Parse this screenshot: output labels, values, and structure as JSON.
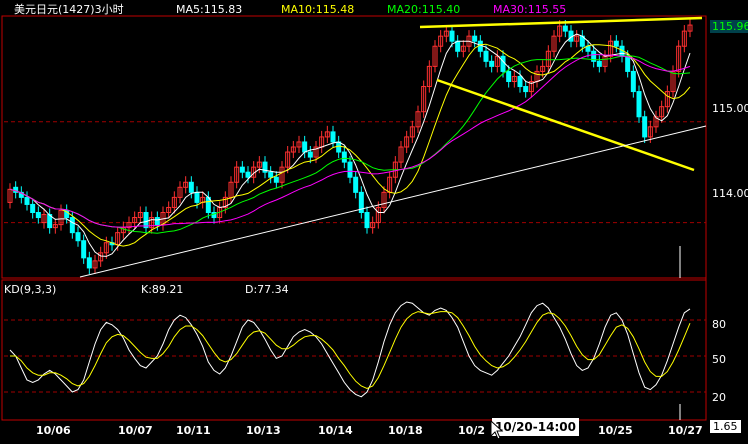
{
  "colors": {
    "ma5": "#ffffff",
    "ma10": "#ffff00",
    "ma20": "#00ff00",
    "ma30": "#ff00ff",
    "k": "#ffffff",
    "d": "#ffff00",
    "up": "#ff3030",
    "down": "#00ffff",
    "trend_yellow": "#ffff00",
    "trend_white": "#ffffff",
    "grid": "#a00000"
  },
  "header": {
    "symbol": "美元日元(1427)3小时",
    "ma5": "MA5:115.83",
    "ma10": "MA10:115.48",
    "ma20": "MA20:115.40",
    "ma30": "MA30:115.55"
  },
  "kd_header": {
    "title": "KD(9,3,3)",
    "k": "K:89.21",
    "d": "D:77.34"
  },
  "price_badge": "115.96",
  "kd_badge": "1.65",
  "cursor_label": "10/20-14:00",
  "x_axis": [
    "10/06",
    "10/07",
    "10/11",
    "10/13",
    "10/14",
    "10/18",
    "10/2",
    "10/25",
    "10/27"
  ],
  "price_ticks": [
    "115.00",
    "114.00"
  ],
  "kd_ticks": [
    "80",
    "50",
    "20"
  ],
  "chart_data": [
    {
      "type": "candlestick",
      "title": "美元日元(1427)3小时",
      "series": [
        {
          "name": "MA5",
          "value": 115.83
        },
        {
          "name": "MA10",
          "value": 115.48
        },
        {
          "name": "MA20",
          "value": 115.4
        },
        {
          "name": "MA30",
          "value": 115.55
        }
      ],
      "y_ticks": [
        115.0,
        114.0
      ],
      "last_price": 115.96,
      "x_categories": [
        "10/06",
        "10/07",
        "10/11",
        "10/13",
        "10/14",
        "10/18",
        "10/2",
        "10/25",
        "10/27"
      ],
      "close": [
        114.33,
        114.3,
        114.25,
        114.18,
        114.1,
        114.05,
        114.08,
        113.95,
        113.98,
        114.12,
        114.05,
        113.9,
        113.82,
        113.65,
        113.55,
        113.62,
        113.7,
        113.8,
        113.78,
        113.9,
        113.95,
        114.0,
        114.05,
        114.1,
        113.95,
        114.05,
        113.98,
        114.1,
        114.15,
        114.25,
        114.35,
        114.4,
        114.3,
        114.2,
        114.25,
        114.1,
        114.05,
        114.15,
        114.25,
        114.4,
        114.55,
        114.5,
        114.45,
        114.55,
        114.6,
        114.5,
        114.45,
        114.4,
        114.55,
        114.7,
        114.75,
        114.8,
        114.7,
        114.65,
        114.75,
        114.85,
        114.9,
        114.8,
        114.7,
        114.6,
        114.45,
        114.3,
        114.1,
        113.95,
        114.0,
        114.15,
        114.3,
        114.45,
        114.6,
        114.75,
        114.85,
        114.95,
        115.1,
        115.35,
        115.55,
        115.75,
        115.85,
        115.9,
        115.8,
        115.7,
        115.75,
        115.85,
        115.8,
        115.7,
        115.6,
        115.55,
        115.65,
        115.5,
        115.4,
        115.45,
        115.35,
        115.3,
        115.4,
        115.5,
        115.55,
        115.7,
        115.85,
        115.95,
        115.9,
        115.8,
        115.85,
        115.75,
        115.7,
        115.6,
        115.55,
        115.65,
        115.8,
        115.75,
        115.65,
        115.5,
        115.3,
        115.05,
        114.85,
        114.95,
        115.05,
        115.15,
        115.3,
        115.5,
        115.75,
        115.9,
        115.96
      ],
      "open": [
        114.2,
        114.35,
        114.3,
        114.25,
        114.18,
        114.1,
        114.0,
        114.08,
        113.95,
        113.98,
        114.12,
        114.05,
        113.9,
        113.82,
        113.65,
        113.55,
        113.62,
        113.7,
        113.8,
        113.78,
        113.9,
        113.95,
        114.0,
        114.05,
        114.1,
        113.95,
        114.05,
        113.98,
        114.1,
        114.15,
        114.25,
        114.35,
        114.4,
        114.3,
        114.2,
        114.25,
        114.1,
        114.05,
        114.15,
        114.25,
        114.4,
        114.55,
        114.5,
        114.45,
        114.55,
        114.6,
        114.5,
        114.45,
        114.4,
        114.55,
        114.7,
        114.75,
        114.8,
        114.7,
        114.65,
        114.75,
        114.85,
        114.9,
        114.8,
        114.7,
        114.6,
        114.45,
        114.3,
        114.1,
        113.95,
        114.0,
        114.15,
        114.3,
        114.45,
        114.6,
        114.75,
        114.85,
        114.95,
        115.1,
        115.35,
        115.55,
        115.75,
        115.85,
        115.9,
        115.8,
        115.7,
        115.75,
        115.85,
        115.8,
        115.7,
        115.6,
        115.55,
        115.65,
        115.5,
        115.4,
        115.45,
        115.35,
        115.3,
        115.4,
        115.5,
        115.55,
        115.7,
        115.85,
        115.95,
        115.9,
        115.8,
        115.85,
        115.75,
        115.7,
        115.6,
        115.55,
        115.65,
        115.8,
        115.75,
        115.65,
        115.5,
        115.3,
        115.05,
        114.85,
        114.95,
        115.05,
        115.15,
        115.3,
        115.5,
        115.75,
        115.9
      ]
    },
    {
      "type": "line",
      "title": "KD(9,3,3)",
      "y_ticks": [
        80,
        50,
        20
      ],
      "series": [
        {
          "name": "K",
          "last": 89.21,
          "values": [
            55,
            50,
            40,
            30,
            28,
            30,
            35,
            38,
            35,
            30,
            25,
            20,
            22,
            30,
            45,
            60,
            72,
            78,
            76,
            72,
            65,
            55,
            48,
            42,
            40,
            45,
            50,
            60,
            72,
            80,
            84,
            82,
            76,
            68,
            58,
            45,
            38,
            35,
            40,
            50,
            62,
            74,
            80,
            78,
            72,
            64,
            55,
            48,
            50,
            58,
            66,
            70,
            72,
            70,
            66,
            60,
            52,
            44,
            36,
            28,
            22,
            18,
            16,
            20,
            30,
            45,
            62,
            76,
            86,
            92,
            95,
            94,
            90,
            86,
            84,
            88,
            90,
            88,
            82,
            74,
            62,
            50,
            42,
            38,
            36,
            34,
            38,
            44,
            50,
            58,
            66,
            76,
            86,
            92,
            94,
            90,
            82,
            74,
            64,
            52,
            42,
            38,
            40,
            48,
            60,
            74,
            84,
            86,
            80,
            68,
            52,
            36,
            24,
            22,
            26,
            34,
            46,
            60,
            74,
            86,
            89.21
          ]
        },
        {
          "name": "D",
          "last": 77.34,
          "values": [
            50,
            50,
            46,
            40,
            36,
            34,
            34,
            36,
            36,
            34,
            31,
            27,
            25,
            27,
            33,
            42,
            52,
            61,
            66,
            68,
            67,
            63,
            58,
            53,
            49,
            48,
            48,
            52,
            58,
            66,
            72,
            75,
            75,
            72,
            67,
            60,
            53,
            47,
            45,
            47,
            52,
            59,
            66,
            70,
            71,
            69,
            64,
            59,
            56,
            56,
            59,
            63,
            66,
            67,
            67,
            64,
            60,
            55,
            48,
            42,
            35,
            29,
            25,
            23,
            25,
            32,
            42,
            53,
            64,
            74,
            81,
            85,
            87,
            86,
            85,
            86,
            87,
            87,
            86,
            82,
            75,
            67,
            58,
            51,
            46,
            42,
            40,
            41,
            44,
            49,
            55,
            62,
            70,
            78,
            84,
            86,
            85,
            81,
            75,
            67,
            58,
            51,
            47,
            47,
            51,
            59,
            67,
            74,
            76,
            73,
            66,
            56,
            45,
            37,
            33,
            33,
            37,
            45,
            55,
            66,
            77.34
          ]
        }
      ]
    }
  ]
}
